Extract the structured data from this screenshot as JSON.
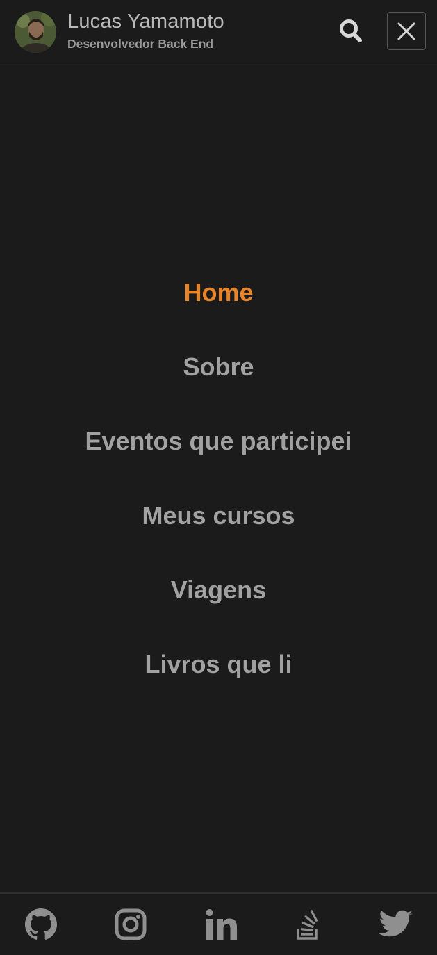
{
  "header": {
    "name": "Lucas Yamamoto",
    "role": "Desenvolvedor Back End",
    "avatar_icon": "avatar-photo",
    "search_icon": "search-icon",
    "close_icon": "close-icon"
  },
  "menu": {
    "items": [
      {
        "label": "Home",
        "active": true
      },
      {
        "label": "Sobre",
        "active": false
      },
      {
        "label": "Eventos que participei",
        "active": false
      },
      {
        "label": "Meus cursos",
        "active": false
      },
      {
        "label": "Viagens",
        "active": false
      },
      {
        "label": "Livros que li",
        "active": false
      }
    ]
  },
  "footer": {
    "social": [
      {
        "icon": "github-icon"
      },
      {
        "icon": "instagram-icon"
      },
      {
        "icon": "linkedin-icon"
      },
      {
        "icon": "stackoverflow-icon"
      },
      {
        "icon": "twitter-icon"
      }
    ]
  },
  "colors": {
    "background": "#1b1b1b",
    "accent": "#e8852a",
    "menu_text": "#a1a1a1",
    "icon": "#8f8f8f"
  }
}
